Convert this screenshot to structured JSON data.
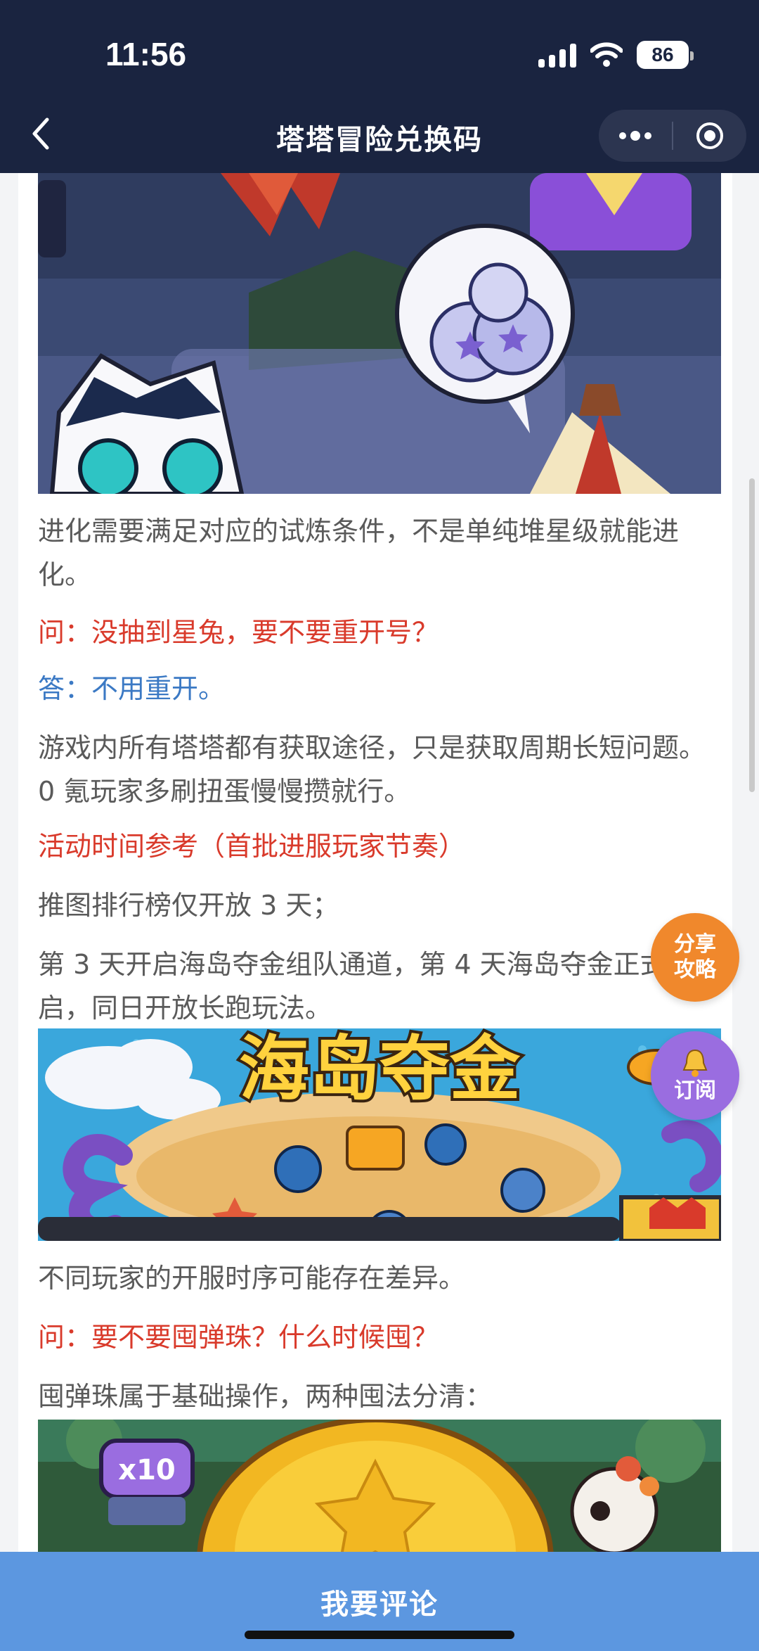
{
  "status": {
    "time": "11:56",
    "battery": "86"
  },
  "nav": {
    "title": "塔塔冒险兑换码"
  },
  "article": {
    "p1": "进化需要满足对应的试炼条件，不是单纯堆星级就能进化。",
    "q1": "问：没抽到星兔，要不要重开号？",
    "a1": "答：不用重开。",
    "p2": "游戏内所有塔塔都有获取途径，只是获取周期长短问题。0 氪玩家多刷扭蛋慢慢攒就行。",
    "h1": "活动时间参考（首批进服玩家节奏）",
    "p3": "推图排行榜仅开放 3 天；",
    "p4": "第 3 天开启海岛夺金组队通道，第 4 天海岛夺金正式开启，同日开放长跑玩法。",
    "banner_title": "海岛夺金",
    "p5": "不同玩家的开服时序可能存在差异。",
    "q2": "问：要不要囤弹珠？什么时候囤？",
    "p6": "囤弹珠属于基础操作，两种囤法分清：",
    "img3_badge": "x10"
  },
  "fabs": {
    "share": "分享攻略",
    "subscribe": "订阅"
  },
  "bottom": {
    "comment": "我要评论"
  },
  "colors": {
    "nav_bg": "#1a2440",
    "bottom_bg": "#5c97e0",
    "question": "#d93a2b",
    "answer": "#3b79c4",
    "share": "#f0882c",
    "subscribe": "#9a6de0"
  }
}
